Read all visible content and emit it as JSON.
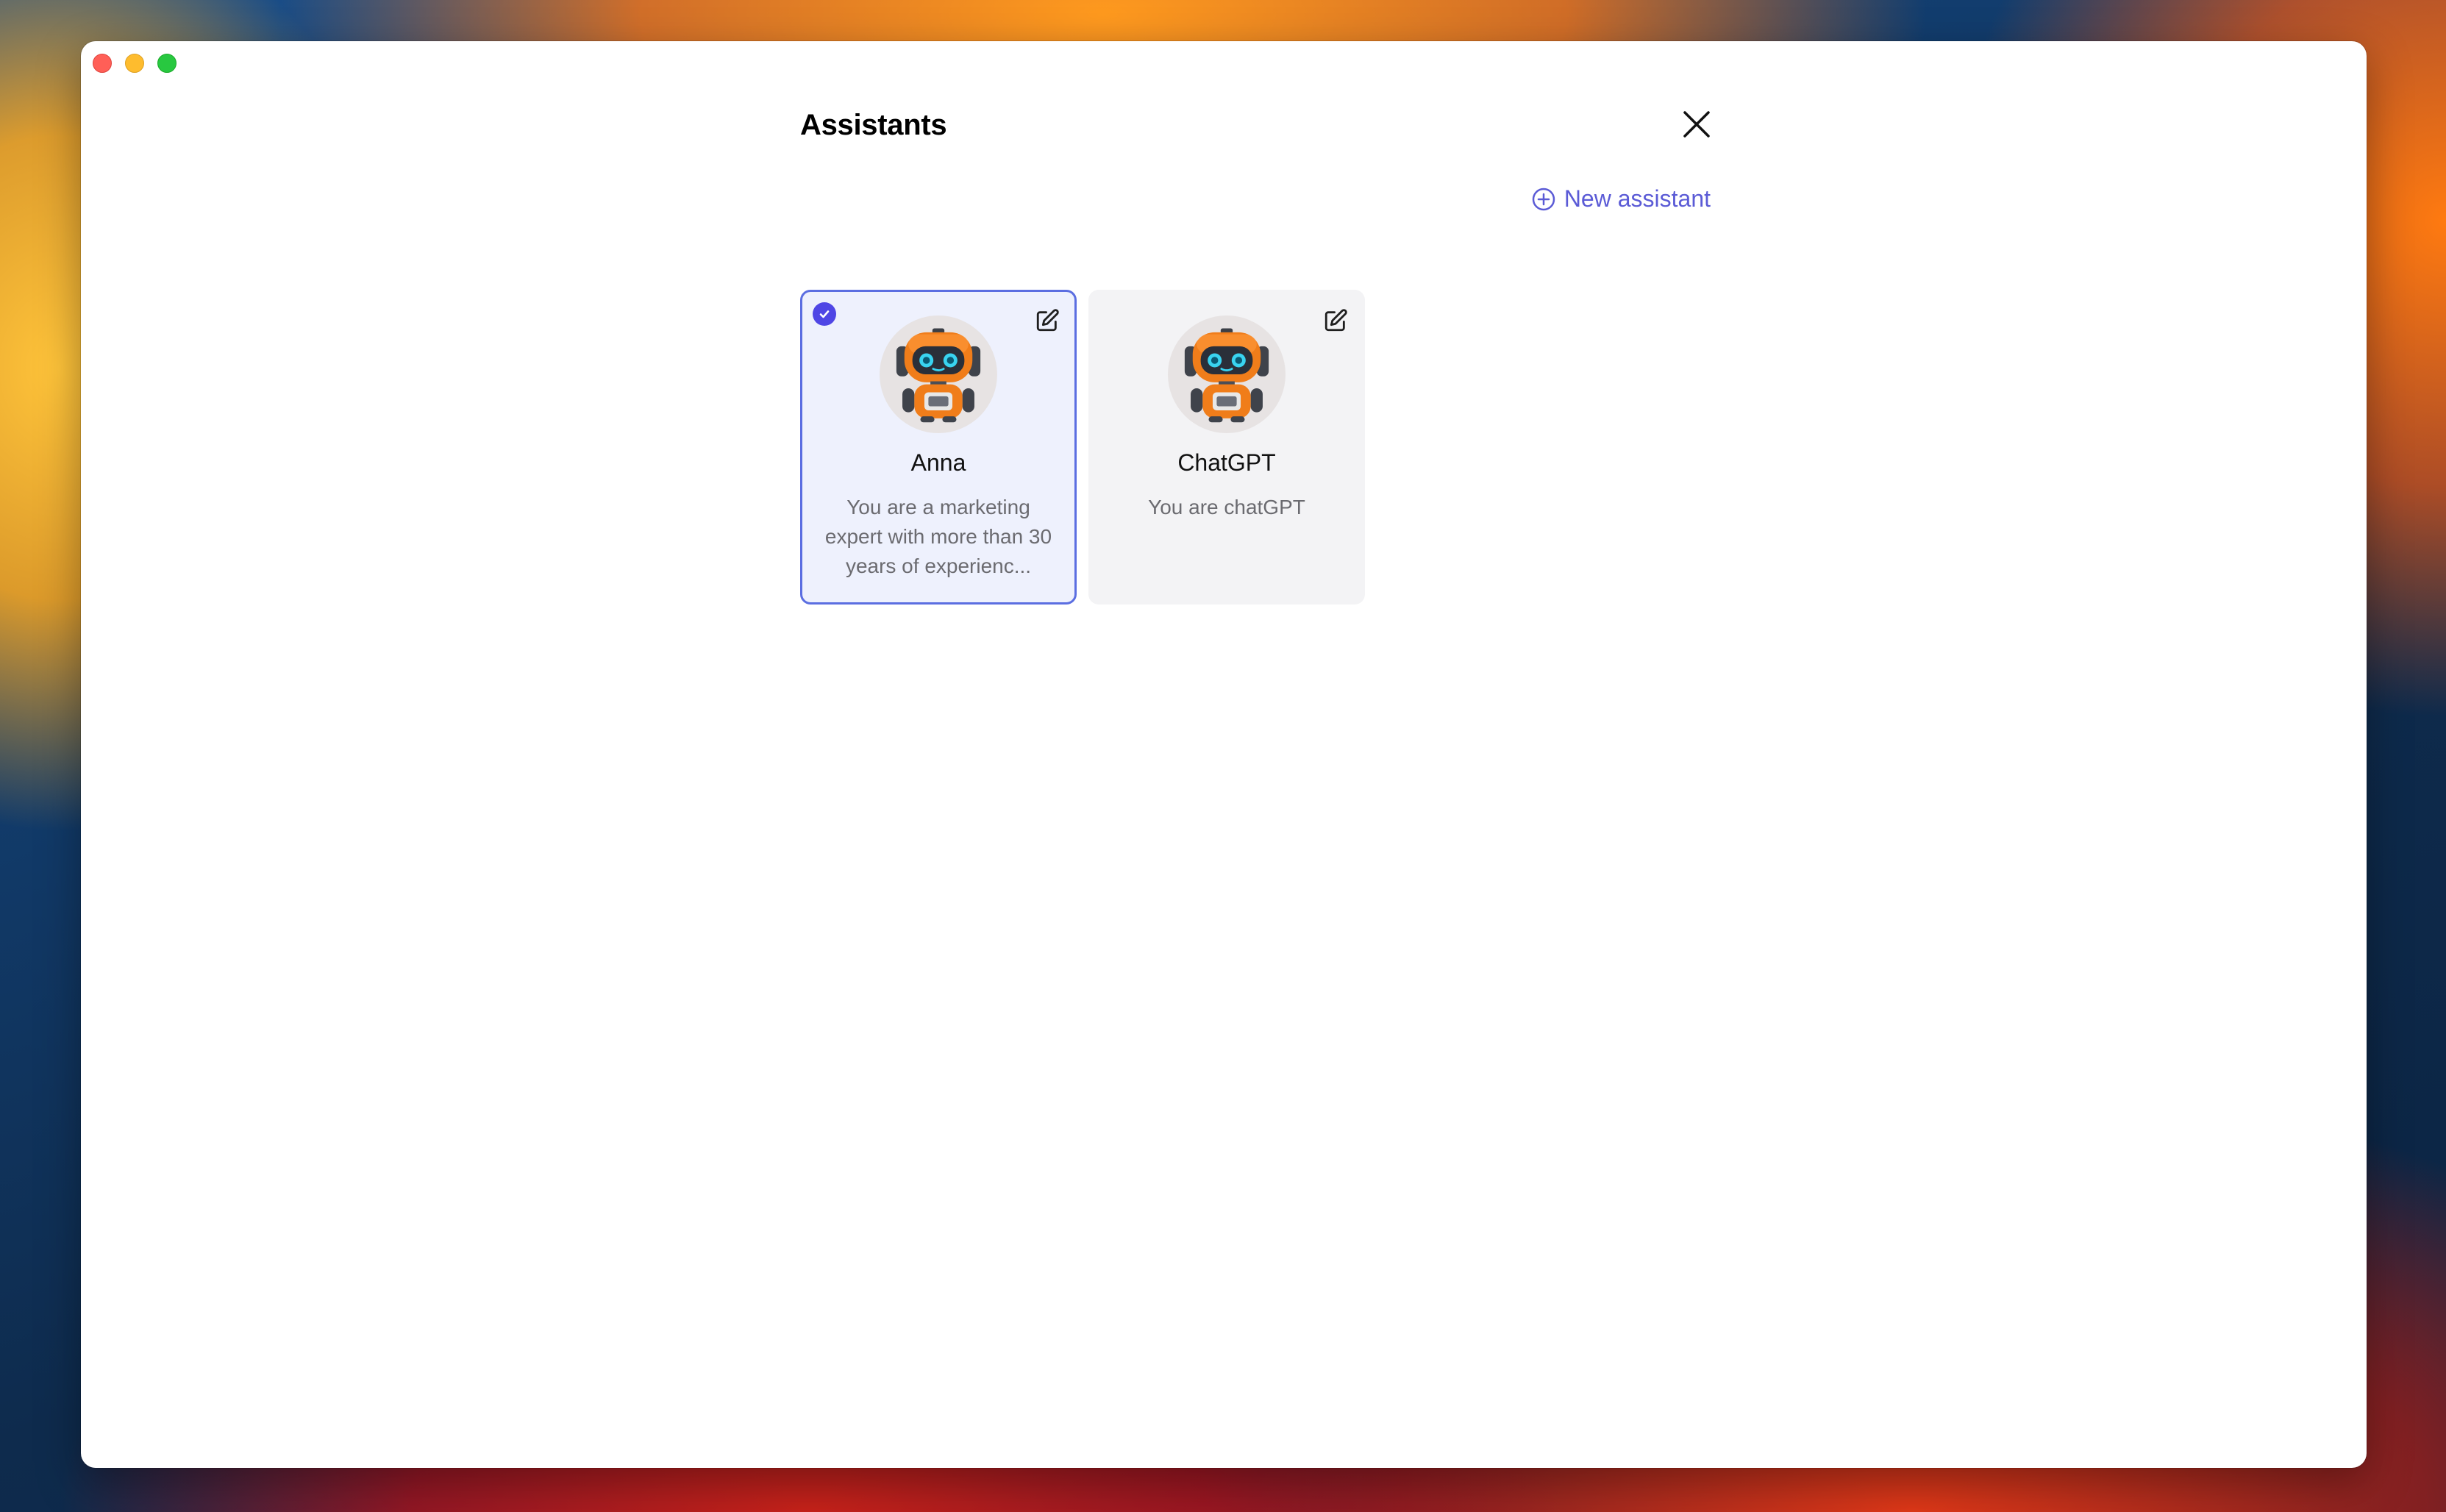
{
  "window": {
    "controls": [
      "close",
      "minimize",
      "zoom"
    ]
  },
  "header": {
    "title": "Assistants",
    "close_icon": "close-icon"
  },
  "actions": {
    "new_assistant_label": "New assistant",
    "new_assistant_icon": "plus-circle-icon"
  },
  "colors": {
    "accent": "#5b5bd6",
    "selected_bg": "#eef1fd",
    "selected_border": "#5b6ee1",
    "card_bg": "#f3f3f5"
  },
  "assistants": [
    {
      "name": "Anna",
      "description": "You are a marketing expert with more than 30 years of experienc...",
      "selected": true,
      "avatar_icon": "robot-avatar-icon",
      "edit_icon": "edit-icon"
    },
    {
      "name": "ChatGPT",
      "description": "You are chatGPT",
      "selected": false,
      "avatar_icon": "robot-avatar-icon",
      "edit_icon": "edit-icon"
    }
  ]
}
